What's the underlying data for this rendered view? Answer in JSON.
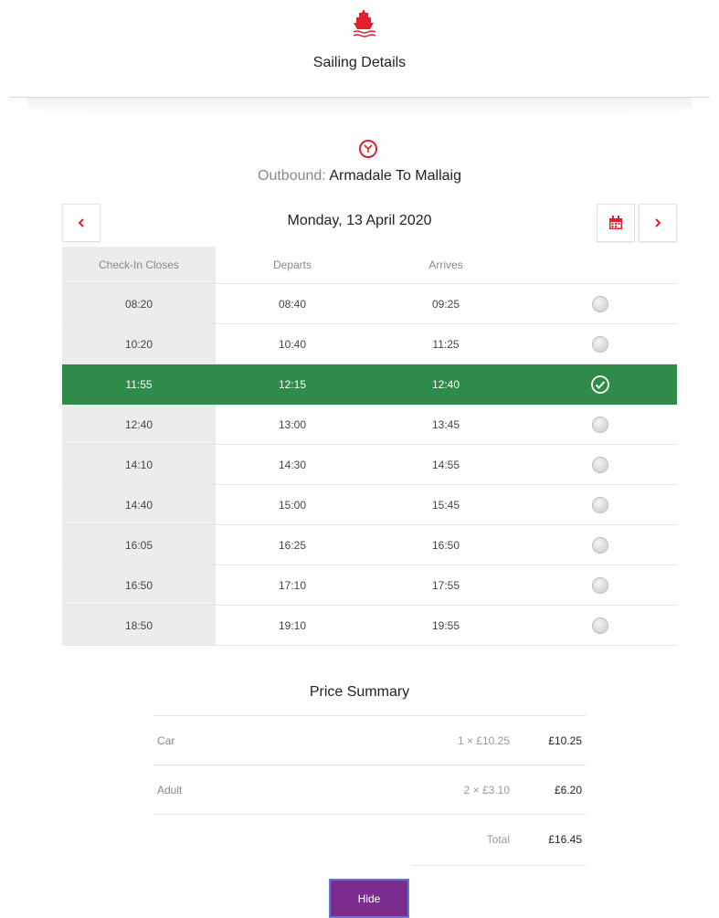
{
  "header": {
    "title": "Sailing Details"
  },
  "sailing": {
    "direction_label": "Outbound:",
    "route": "Armadale To Mallaig",
    "date": "Monday, 13 April 2020"
  },
  "table": {
    "headers": [
      "Check-In Closes",
      "Departs",
      "Arrives",
      ""
    ],
    "rows": [
      {
        "checkin": "08:20",
        "departs": "08:40",
        "arrives": "09:25",
        "selected": false
      },
      {
        "checkin": "10:20",
        "departs": "10:40",
        "arrives": "11:25",
        "selected": false
      },
      {
        "checkin": "11:55",
        "departs": "12:15",
        "arrives": "12:40",
        "selected": true
      },
      {
        "checkin": "12:40",
        "departs": "13:00",
        "arrives": "13:45",
        "selected": false
      },
      {
        "checkin": "14:10",
        "departs": "14:30",
        "arrives": "14:55",
        "selected": false
      },
      {
        "checkin": "14:40",
        "departs": "15:00",
        "arrives": "15:45",
        "selected": false
      },
      {
        "checkin": "16:05",
        "departs": "16:25",
        "arrives": "16:50",
        "selected": false
      },
      {
        "checkin": "16:50",
        "departs": "17:10",
        "arrives": "17:55",
        "selected": false
      },
      {
        "checkin": "18:50",
        "departs": "19:10",
        "arrives": "19:55",
        "selected": false
      }
    ]
  },
  "price_summary": {
    "title": "Price Summary",
    "items": [
      {
        "name": "Car",
        "calc": "1 × £10.25",
        "amount": "£10.25"
      },
      {
        "name": "Adult",
        "calc": "2 × £3.10",
        "amount": "£6.20"
      }
    ],
    "total_label": "Total",
    "total_amount": "£16.45"
  },
  "actions": {
    "hide_label": "Hide"
  },
  "icons": {
    "logo": "ship-logo-icon",
    "clock": "clock-icon",
    "prev": "chevron-left-icon",
    "calendar": "calendar-icon",
    "next": "chevron-right-icon",
    "selected": "check-circle-icon",
    "unselected": "radio-icon"
  },
  "colors": {
    "brand_red": "#e0202c",
    "selected_row": "#2e8b4a",
    "hide_button": "#7b2d8e"
  }
}
